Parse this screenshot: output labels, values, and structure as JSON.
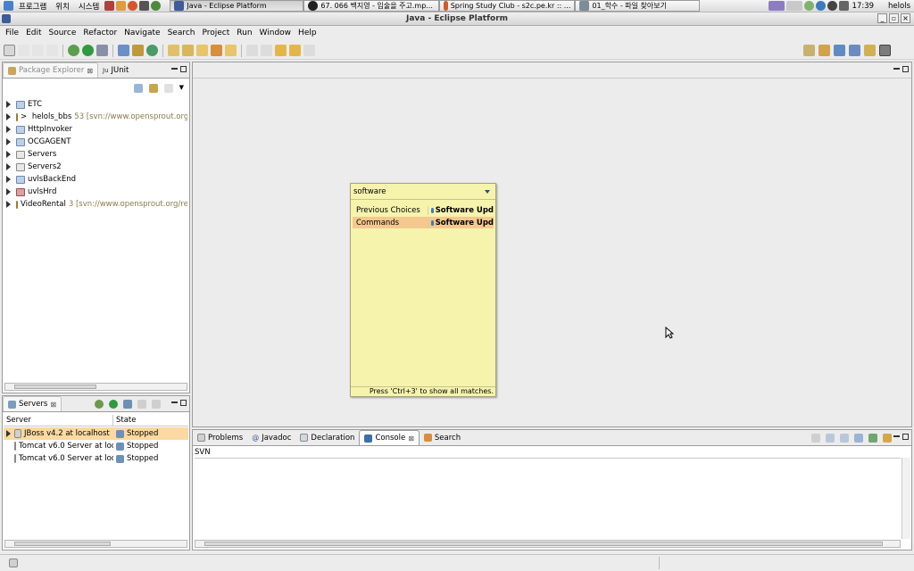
{
  "gnome_panel": {
    "menus": [
      "프로그램",
      "위치",
      "시스템"
    ],
    "tasks": [
      {
        "label": "Java - Eclipse Platform",
        "active": true
      },
      {
        "label": "67. 066 백지영 - 입술을 주고.mp...",
        "active": false
      },
      {
        "label": "Spring Study Club - s2c.pe.kr :: ...",
        "active": false
      },
      {
        "label": "01_학수 - 파일 찾아보기",
        "active": false
      }
    ],
    "clock": "17:39",
    "user": "helols"
  },
  "window": {
    "title": "Java - Eclipse Platform",
    "buttons": [
      "_",
      "▫",
      "×"
    ]
  },
  "menubar": [
    "File",
    "Edit",
    "Source",
    "Refactor",
    "Navigate",
    "Search",
    "Project",
    "Run",
    "Window",
    "Help"
  ],
  "package_explorer": {
    "tabs": [
      "Package Explorer",
      "JUnit"
    ],
    "junit_prefix": "Ju",
    "items": [
      {
        "name": "ETC",
        "prefix": "",
        "extra": ""
      },
      {
        "name": "helols_bbs",
        "prefix": "> ",
        "extra": "53 [svn://www.opensprout.org/repo"
      },
      {
        "name": "HttpInvoker",
        "prefix": "",
        "extra": ""
      },
      {
        "name": "OCGAGENT",
        "prefix": "",
        "extra": ""
      },
      {
        "name": "Servers",
        "prefix": "",
        "extra": ""
      },
      {
        "name": "Servers2",
        "prefix": "",
        "extra": ""
      },
      {
        "name": "uvlsBackEnd",
        "prefix": "",
        "extra": ""
      },
      {
        "name": "uvlsHrd",
        "prefix": "",
        "extra": ""
      },
      {
        "name": "VideoRental",
        "prefix": "",
        "extra": "3 [svn://www.opensprout.org/repos/"
      }
    ]
  },
  "servers": {
    "tab": "Servers",
    "columns": [
      "Server",
      "State"
    ],
    "rows": [
      {
        "server": "JBoss v4.2 at localhost",
        "state": "Stopped",
        "selected": true
      },
      {
        "server": "Tomcat v6.0 Server at loc",
        "state": "Stopped",
        "selected": false
      },
      {
        "server": "Tomcat v6.0 Server at loc",
        "state": "Stopped",
        "selected": false
      }
    ]
  },
  "quick_access": {
    "input": "software",
    "rows": [
      {
        "category": "Previous Choices",
        "value": "Software Upd",
        "selected": false
      },
      {
        "category": "Commands",
        "value": "Software Upd",
        "selected": true
      }
    ],
    "footer": "Press 'Ctrl+3' to show all matches."
  },
  "bottom_panel": {
    "tabs": [
      "Problems",
      "Javadoc",
      "Declaration",
      "Console",
      "Search"
    ],
    "active_tab": "Console",
    "console_title": "SVN"
  },
  "colors": {
    "selection": "#fbd9a1",
    "popup_bg": "#f6f3ad",
    "popup_sel": "#f4c88e"
  }
}
